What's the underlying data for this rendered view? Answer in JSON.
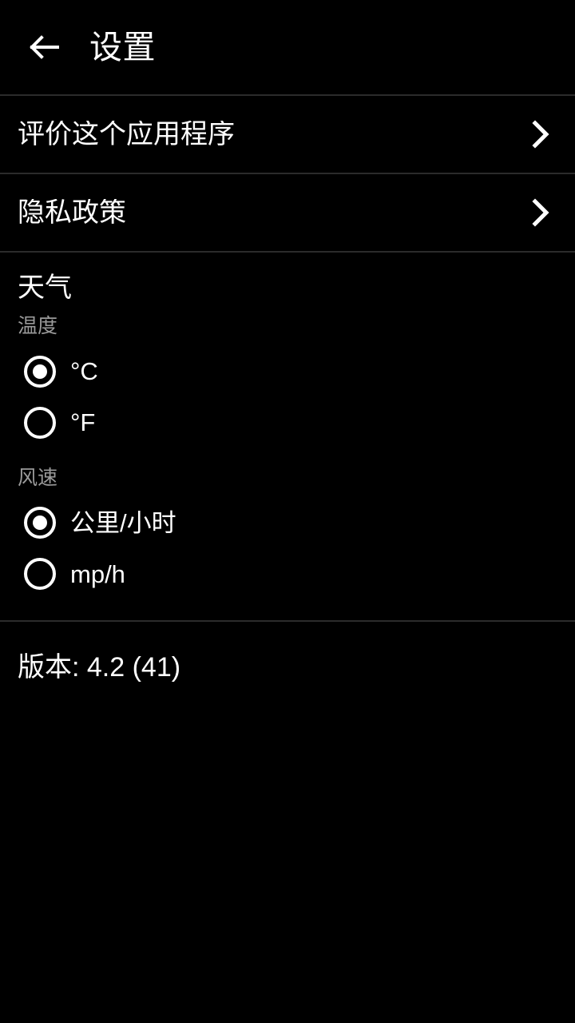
{
  "appbar": {
    "back_icon": "arrow-left-icon",
    "title": "设置"
  },
  "nav_rows": [
    {
      "label": "评价这个应用程序",
      "chevron_icon": "chevron-right-icon"
    },
    {
      "label": "隐私政策",
      "chevron_icon": "chevron-right-icon"
    }
  ],
  "weather": {
    "section_title": "天气",
    "groups": [
      {
        "label": "温度",
        "options": [
          {
            "label": "°C",
            "selected": true
          },
          {
            "label": "°F",
            "selected": false
          }
        ]
      },
      {
        "label": "风速",
        "options": [
          {
            "label": "公里/小时",
            "selected": true
          },
          {
            "label": "mp/h",
            "selected": false
          }
        ]
      }
    ]
  },
  "version": {
    "text": "版本: 4.2 (41)"
  },
  "colors": {
    "background": "#000000",
    "text_primary": "#ffffff",
    "text_secondary": "#9a9a9a",
    "divider": "#2b2b2b"
  }
}
